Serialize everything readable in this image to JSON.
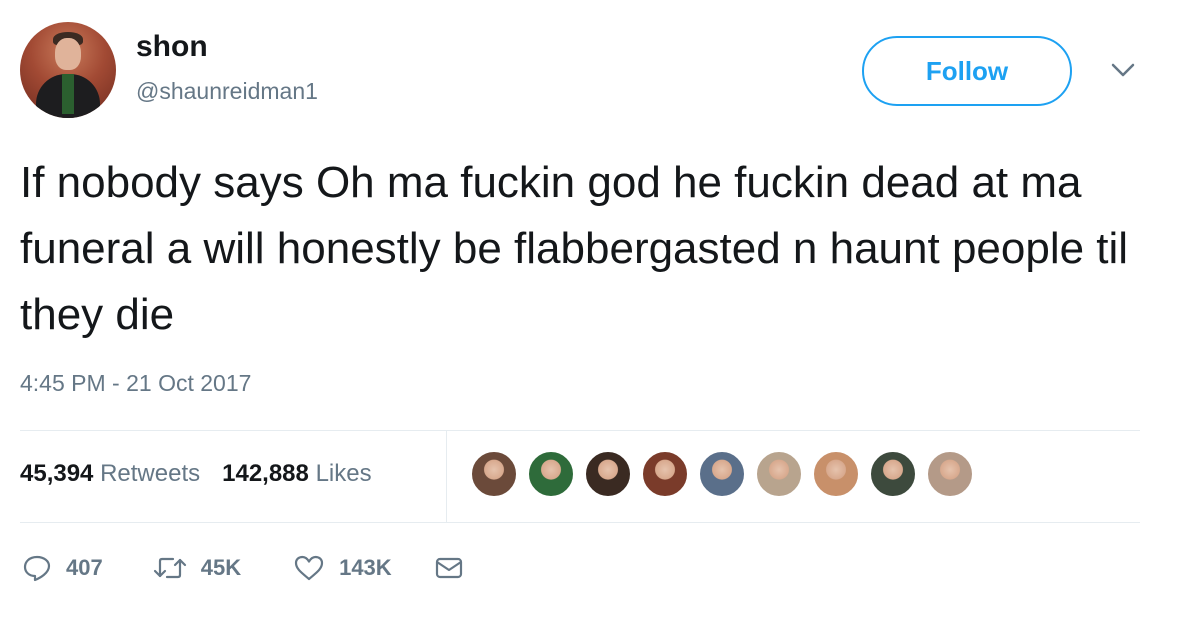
{
  "user": {
    "display_name": "shon",
    "handle": "@shaunreidman1"
  },
  "follow_label": "Follow",
  "tweet": {
    "text": "If nobody says Oh ma fuckin god he fuckin dead at ma funeral a will honestly be flabbergasted n haunt people til they die",
    "timestamp": "4:45 PM - 21 Oct 2017"
  },
  "stats": {
    "retweets_count": "45,394",
    "retweets_label": "Retweets",
    "likes_count": "142,888",
    "likes_label": "Likes"
  },
  "liker_avatars": [
    {
      "color": "#6b4a3a"
    },
    {
      "color": "#2e6b3a"
    },
    {
      "color": "#3a2a22"
    },
    {
      "color": "#7a3b2a"
    },
    {
      "color": "#5a6f8a"
    },
    {
      "color": "#b8a48e"
    },
    {
      "color": "#c8906a"
    },
    {
      "color": "#3d4a3d"
    },
    {
      "color": "#b49a88"
    }
  ],
  "actions": {
    "reply_count": "407",
    "retweet_count": "45K",
    "like_count": "143K"
  },
  "icons": {
    "reply": "reply-icon",
    "retweet": "retweet-icon",
    "like": "heart-icon",
    "dm": "envelope-icon",
    "menu": "chevron-down-icon"
  },
  "colors": {
    "accent": "#1da1f2",
    "secondary_text": "#657786",
    "divider": "#e6ecf0"
  }
}
